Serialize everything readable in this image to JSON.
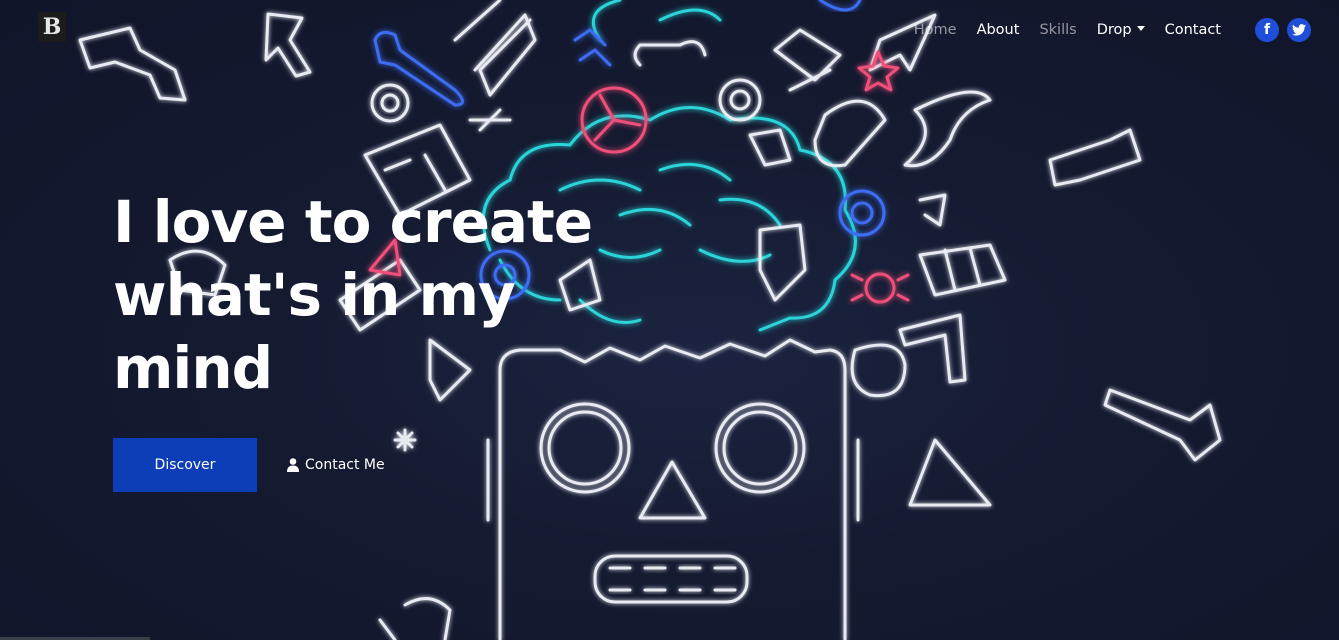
{
  "brand": {
    "letter": "B"
  },
  "nav": {
    "items": [
      {
        "label": "Home",
        "active": false
      },
      {
        "label": "About",
        "active": true
      },
      {
        "label": "Skills",
        "active": false
      },
      {
        "label": "Drop",
        "active": true
      },
      {
        "label": "Contact",
        "active": true
      }
    ],
    "social": [
      {
        "icon": "facebook-icon",
        "glyph": "f"
      },
      {
        "icon": "twitter-icon"
      }
    ]
  },
  "hero": {
    "headline": [
      "I love to create",
      "what's in my",
      "mind"
    ],
    "discover_label": "Discover",
    "contact_label": "Contact Me"
  },
  "colors": {
    "background": "#131a2e",
    "primary_button": "#0d3eb8",
    "social_button": "#1f4fd8",
    "neon_white": "#e8ecf2",
    "neon_cyan": "#2ad4d9",
    "neon_blue": "#3d6df2",
    "neon_red": "#f0507a"
  }
}
